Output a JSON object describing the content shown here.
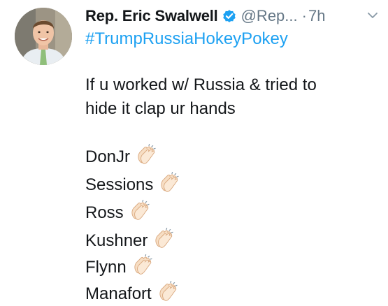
{
  "tweet": {
    "display_name": "Rep. Eric Swalwell",
    "handle": "@Rep...",
    "separator": "·",
    "time": "7h",
    "hashtag": "#TrumpRussiaHokeyPokey",
    "body_lines": [
      "If u worked w/ Russia & tried to",
      "hide it clap ur hands"
    ],
    "names": [
      "DonJr",
      "Sessions",
      "Ross",
      "Kushner",
      "Flynn",
      "Manafort"
    ],
    "icons": {
      "verified": "verified-badge-icon",
      "chevron": "chevron-down-icon",
      "clap": "clapping-hands-icon",
      "avatar": "profile-photo"
    },
    "colors": {
      "link": "#1da1f2",
      "muted": "#657786",
      "text": "#14171a",
      "verified": "#1da1f2"
    }
  }
}
